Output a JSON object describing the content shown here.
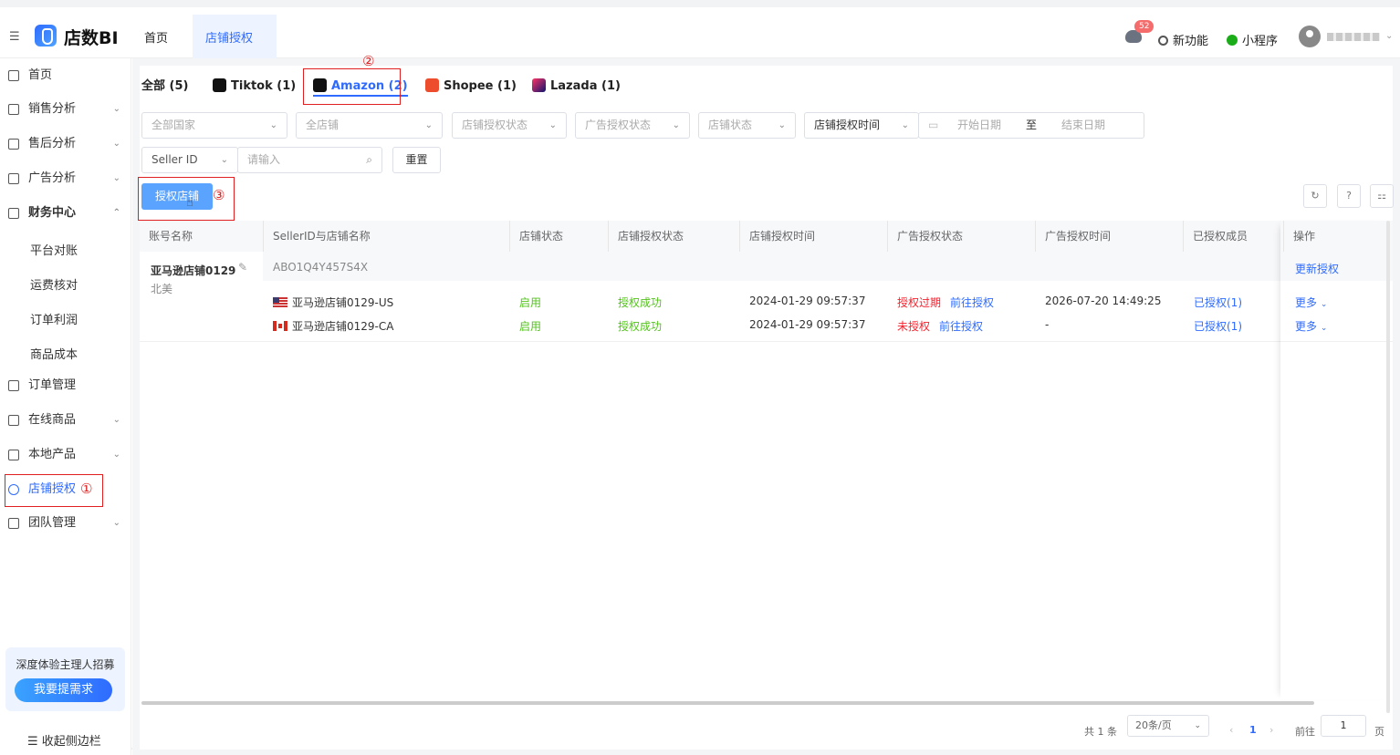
{
  "header": {
    "brand": "店数BI",
    "tabs": [
      "首页",
      "店铺授权"
    ],
    "badge": "52",
    "new_feature": "新功能",
    "mini_program": "小程序"
  },
  "sidebar": {
    "items": [
      {
        "label": "首页"
      },
      {
        "label": "销售分析"
      },
      {
        "label": "售后分析"
      },
      {
        "label": "广告分析"
      },
      {
        "label": "财务中心"
      },
      {
        "label": "订单管理"
      },
      {
        "label": "在线商品"
      },
      {
        "label": "本地产品"
      },
      {
        "label": "店铺授权"
      },
      {
        "label": "团队管理"
      }
    ],
    "sub_items": [
      "平台对账",
      "运费核对",
      "订单利润",
      "商品成本"
    ],
    "promo_title": "深度体验主理人招募",
    "promo_button": "我要提需求",
    "collapse": "收起侧边栏"
  },
  "annotations": {
    "m1": "①",
    "m2": "②",
    "m3": "③"
  },
  "platform_tabs": [
    "全部 (5)",
    "Tiktok (1)",
    "Amazon (2)",
    "Shopee (1)",
    "Lazada (1)"
  ],
  "filters": {
    "country": "全部国家",
    "store": "全店铺",
    "store_auth_status": "店铺授权状态",
    "ad_auth_status": "广告授权状态",
    "store_status": "店铺状态",
    "auth_time": "店铺授权时间",
    "start": "开始日期",
    "to": "至",
    "end": "结束日期",
    "seller_id": "Seller ID",
    "input_placeholder": "请输入",
    "reset": "重置"
  },
  "actions": {
    "authorize": "授权店铺"
  },
  "table": {
    "headers": [
      "账号名称",
      "SellerID与店铺名称",
      "店铺状态",
      "店铺授权状态",
      "店铺授权时间",
      "广告授权状态",
      "广告授权时间",
      "已授权成员",
      "操作"
    ],
    "account": {
      "name": "亚马逊店铺0129",
      "region": "北美",
      "seller_id": "ABO1Q4Y457S4X",
      "update": "更新授权"
    },
    "rows": [
      {
        "store": "亚马逊店铺0129-US",
        "status": "启用",
        "auth": "授权成功",
        "time": "2024-01-29 09:57:37",
        "ad_status": "授权过期",
        "ad_link": "前往授权",
        "ad_time": "2026-07-20 14:49:25",
        "members": "已授权(1)",
        "more": "更多"
      },
      {
        "store": "亚马逊店铺0129-CA",
        "status": "启用",
        "auth": "授权成功",
        "time": "2024-01-29 09:57:37",
        "ad_status": "未授权",
        "ad_link": "前往授权",
        "ad_time": "-",
        "members": "已授权(1)",
        "more": "更多"
      }
    ]
  },
  "pagination": {
    "total": "共 1 条",
    "page_size": "20条/页",
    "page": "1",
    "goto": "前往",
    "goto_value": "1",
    "unit": "页"
  }
}
